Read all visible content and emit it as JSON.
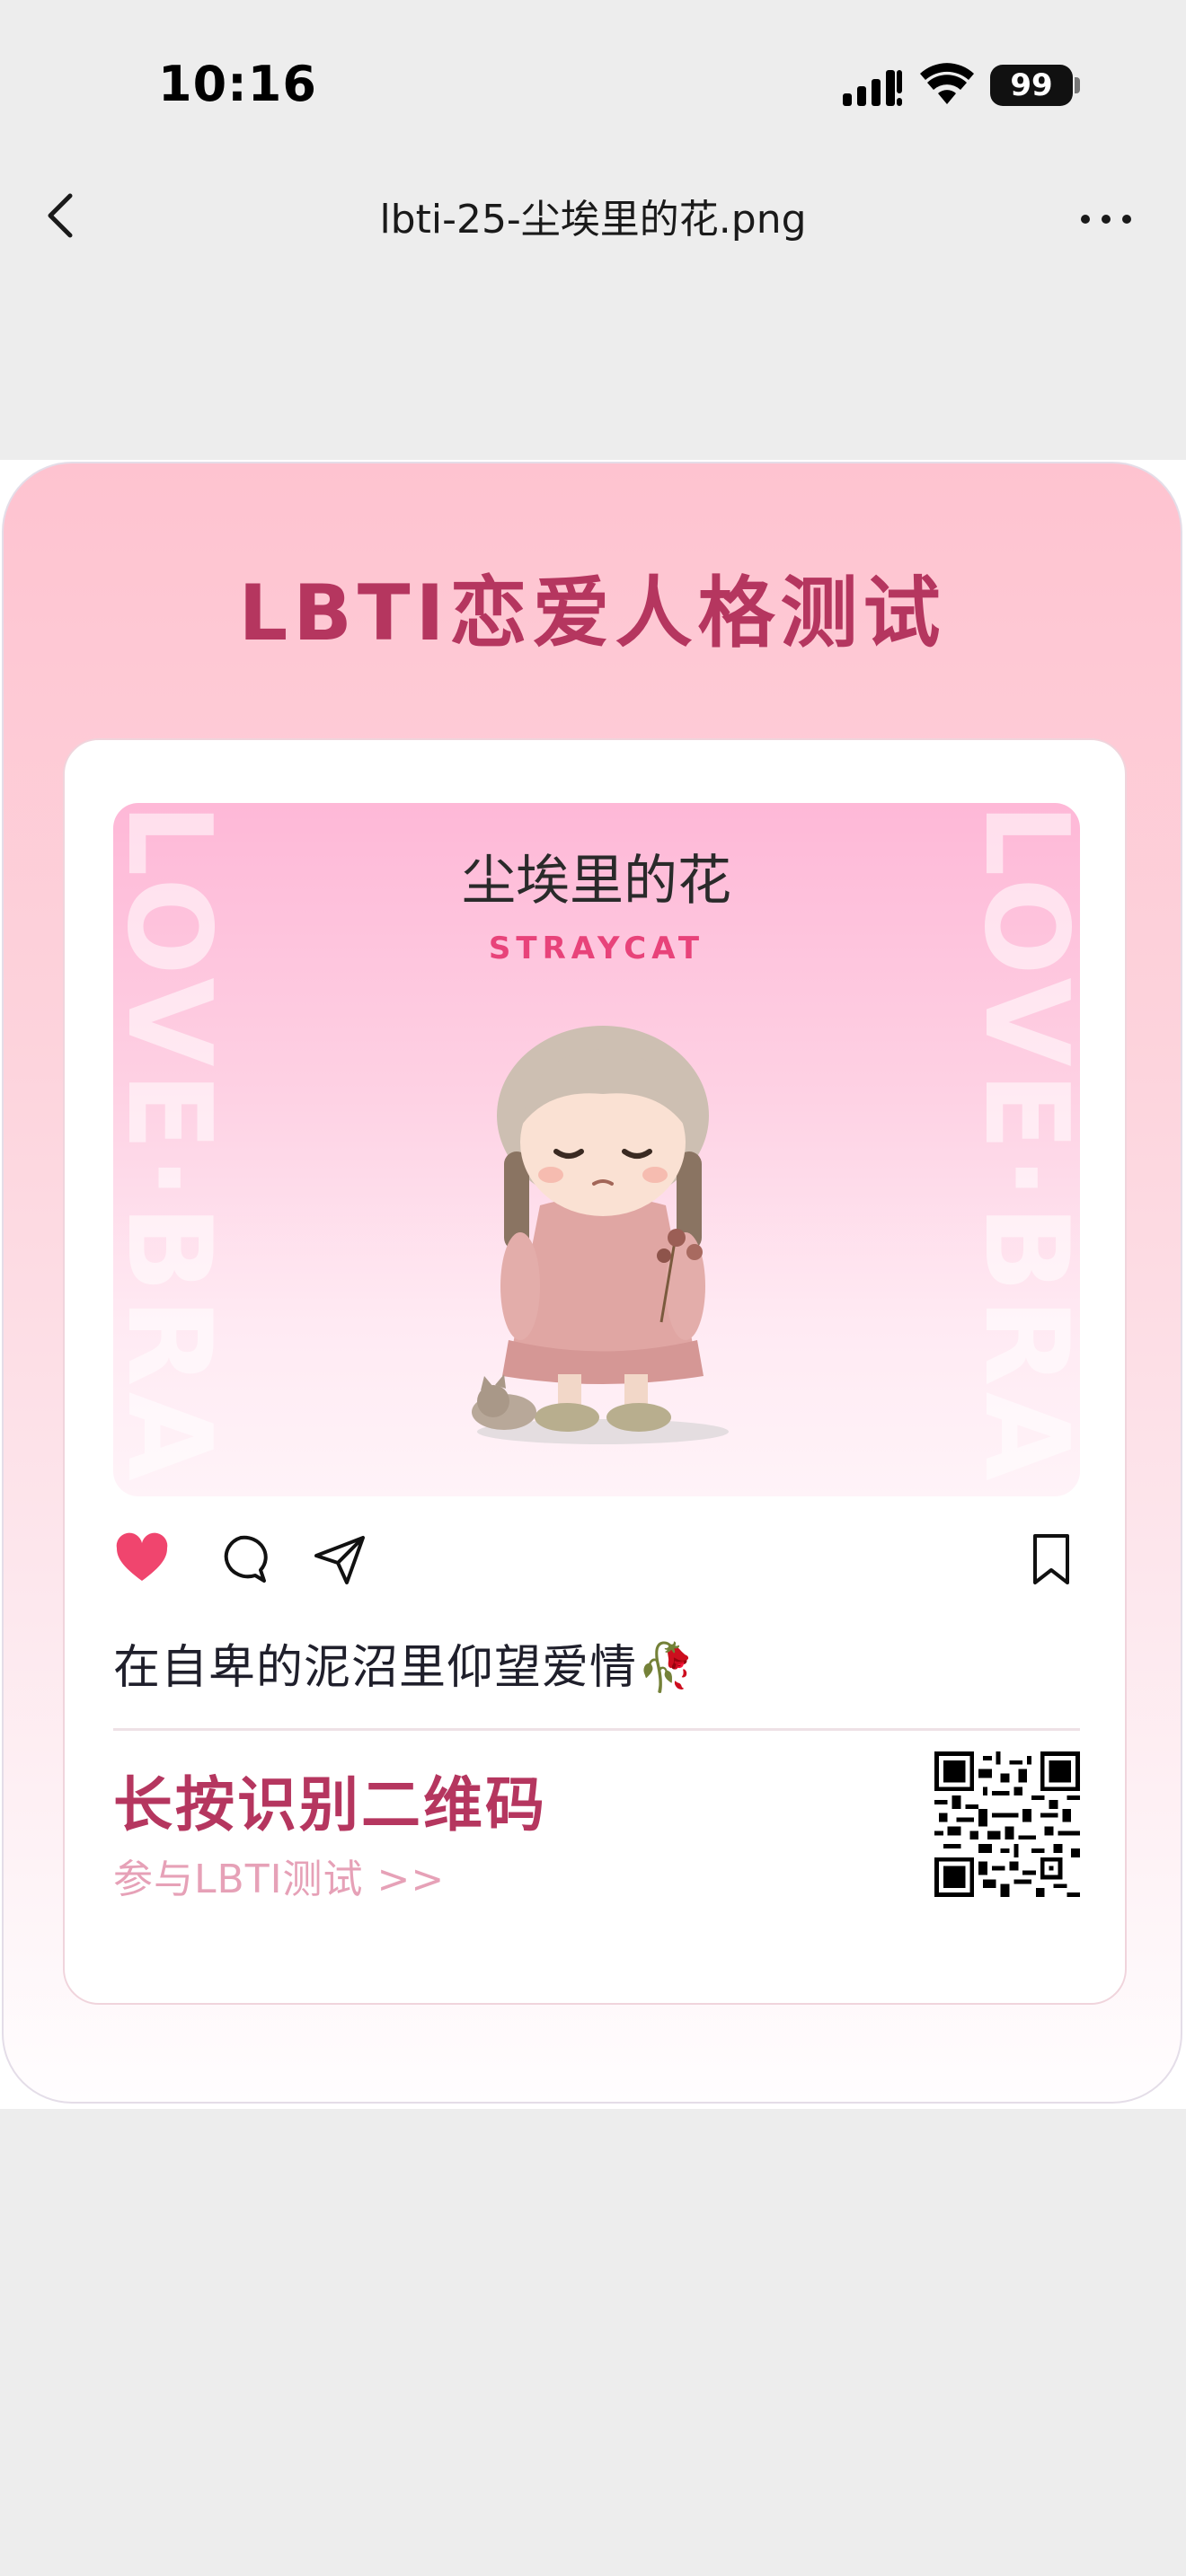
{
  "status_bar": {
    "time": "10:16",
    "battery": "99"
  },
  "nav": {
    "title": "lbti-25-尘埃里的花.png"
  },
  "poster": {
    "title": "LBTI恋爱人格测试",
    "watermark": "LOVE·BRAIN",
    "type_name": "尘埃里的花",
    "type_code": "STRAYCAT",
    "caption": "在自卑的泥沼里仰望爱情🥀",
    "cta_title": "长按识别二维码",
    "cta_sub": "参与LBTI测试 >>"
  },
  "colors": {
    "accent": "#b5365f",
    "type_code": "#e8437a",
    "heart": "#f0456e",
    "cta_sub": "#e6a1b7"
  },
  "icons": [
    "chevron-left-icon",
    "more-icon",
    "heart-icon",
    "comment-icon",
    "send-icon",
    "bookmark-icon",
    "qr-code"
  ]
}
